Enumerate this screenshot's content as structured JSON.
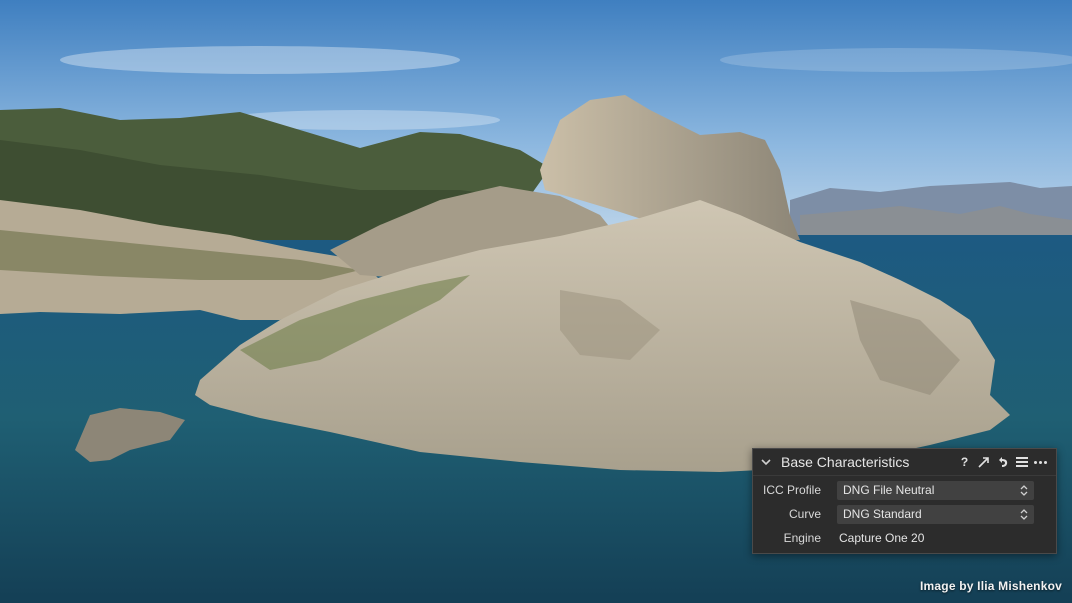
{
  "panel": {
    "title": "Base Characteristics",
    "icons": [
      "help-icon",
      "expand-icon",
      "reset-icon",
      "menu-icon",
      "more-icon"
    ],
    "help_glyph": "?",
    "rows": [
      {
        "label": "ICC Profile",
        "value": "DNG File Neutral",
        "kind": "select"
      },
      {
        "label": "Curve",
        "value": "DNG Standard",
        "kind": "select"
      },
      {
        "label": "Engine",
        "value": "Capture One 20",
        "kind": "static"
      }
    ]
  },
  "credit": "Image by Ilia Mishenkov",
  "colors": {
    "panel_bg": "#2c2c2c",
    "select_bg": "#414141",
    "sea": "#1f5470",
    "sky": "#8fb8dc"
  }
}
